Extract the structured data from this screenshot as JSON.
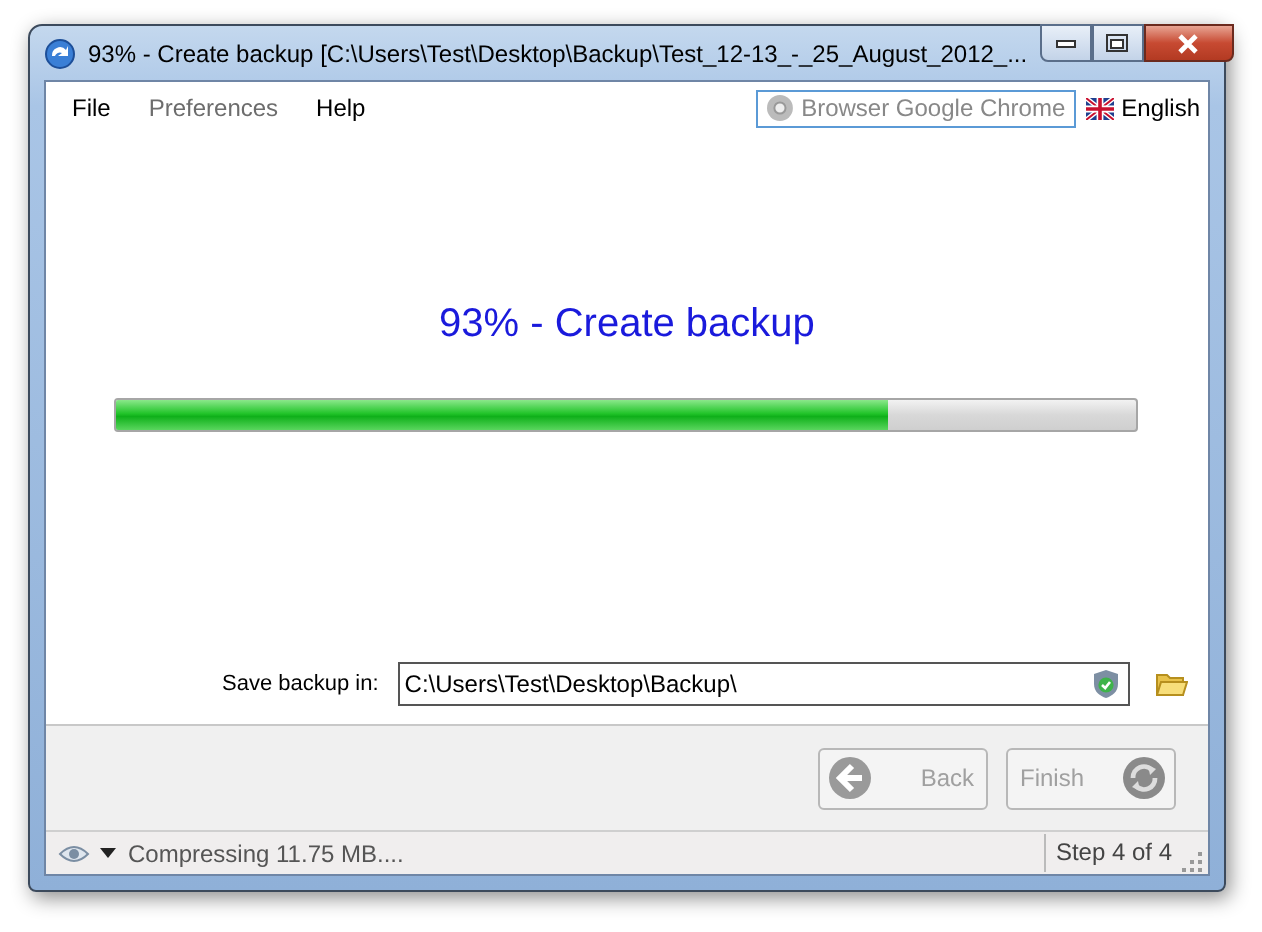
{
  "window": {
    "title": "93% - Create backup [C:\\Users\\Test\\Desktop\\Backup\\Test_12-13_-_25_August_2012_..."
  },
  "menu": [
    {
      "label": "File",
      "disabled": false
    },
    {
      "label": "Preferences",
      "disabled": true
    },
    {
      "label": "Help",
      "disabled": false
    }
  ],
  "browser_field": {
    "placeholder": "Browser Google Chrome"
  },
  "language": {
    "label": "English"
  },
  "heading": "93% - Create backup",
  "progress": {
    "level": 0.756
  },
  "save_location": {
    "label": "Save backup in:",
    "value": "C:\\Users\\Test\\Desktop\\Backup\\"
  },
  "buttons": [
    {
      "kind": "back",
      "label": "Back",
      "disabled": true
    },
    {
      "kind": "finish",
      "label": "Finish",
      "disabled": true
    }
  ],
  "status_bar": {
    "message": "Compressing 11.75 MB....",
    "step": "Step 4 of 4"
  }
}
